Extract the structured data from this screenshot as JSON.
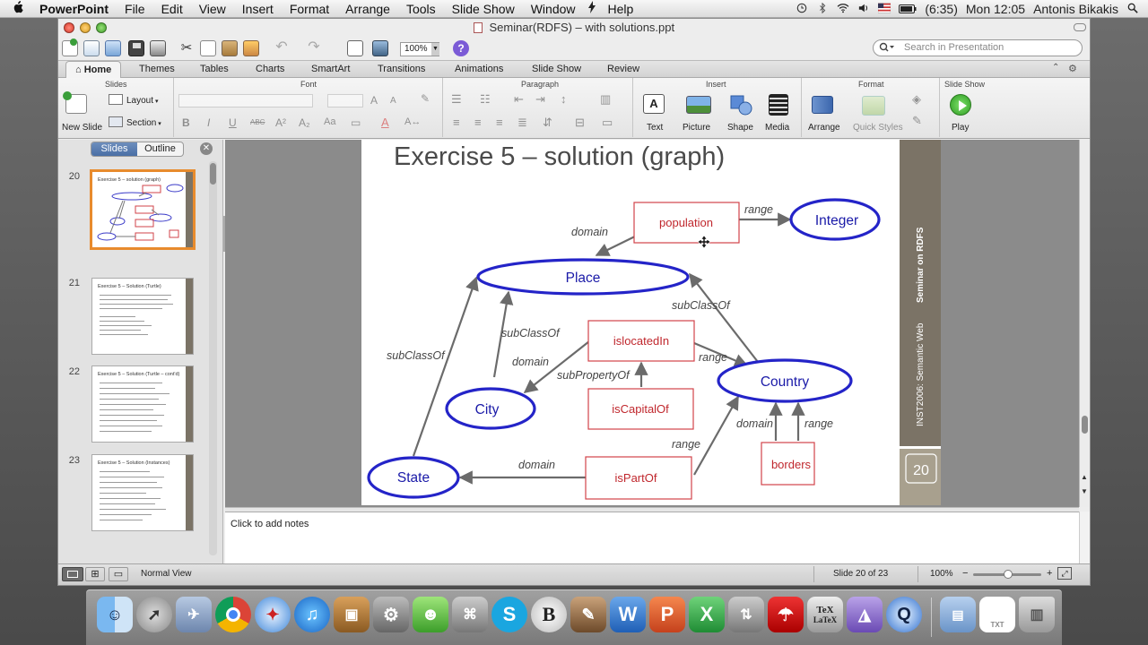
{
  "menubar": {
    "apple": "",
    "app_name": "PowerPoint",
    "menus": [
      "File",
      "Edit",
      "View",
      "Insert",
      "Format",
      "Arrange",
      "Tools",
      "Slide Show",
      "Window",
      "Help"
    ],
    "battery": "(6:35)",
    "clock": "Mon 12:05",
    "user": "Antonis Bikakis"
  },
  "window": {
    "title": "Seminar(RDFS) – with solutions.ppt",
    "zoom_field": "100%",
    "search_placeholder": "Search in Presentation"
  },
  "ribbon": {
    "tabs": [
      "Home",
      "Themes",
      "Tables",
      "Charts",
      "SmartArt",
      "Transitions",
      "Animations",
      "Slide Show",
      "Review"
    ],
    "groups": {
      "slides": "Slides",
      "font": "Font",
      "paragraph": "Paragraph",
      "insert": "Insert",
      "format": "Format",
      "slideshow": "Slide Show"
    },
    "buttons": {
      "new_slide": "New Slide",
      "layout": "Layout",
      "section": "Section",
      "text": "Text",
      "picture": "Picture",
      "shape": "Shape",
      "media": "Media",
      "arrange": "Arrange",
      "quick_styles": "Quick Styles",
      "play": "Play"
    }
  },
  "leftpane": {
    "tab_slides": "Slides",
    "tab_outline": "Outline",
    "thumbnails": [
      {
        "num": "20",
        "title": "Exercise 5 – solution (graph)"
      },
      {
        "num": "21",
        "title": "Exercise 5 – Solution (Turtle)"
      },
      {
        "num": "22",
        "title": "Exercise 5 – Solution (Turtle – cont'd)"
      },
      {
        "num": "23",
        "title": "Exercise 5 – Solution (Instances)"
      }
    ]
  },
  "slide": {
    "title": "Exercise 5 – solution (graph)",
    "side_text_course": "INST2006: Semantic Web",
    "side_text_seminar": "Seminar on RDFS",
    "page_number": "20",
    "nodes": {
      "population": "population",
      "integer": "Integer",
      "place": "Place",
      "islocatedin": "islocatedIn",
      "country": "Country",
      "city": "City",
      "iscapitalof": "isCapitalOf",
      "state": "State",
      "ispartof": "isPartOf",
      "borders": "borders"
    },
    "edges": {
      "range_1": "range",
      "domain_1": "domain",
      "subclassof_1": "subClassOf",
      "subclassof_2": "subClassOf",
      "subclassof_3": "subClassOf",
      "domain_2": "domain",
      "range_2": "range",
      "subpropertyof": "subPropertyOf",
      "range_3": "range",
      "domain_3": "domain",
      "domain_4": "domain",
      "range_4": "range"
    }
  },
  "notes": {
    "placeholder": "Click to add notes"
  },
  "statusbar": {
    "view": "Normal View",
    "slide_position": "Slide 20 of 23",
    "zoom": "100%"
  },
  "dock": {
    "skype": "S",
    "bbedit": "B",
    "word": "W",
    "powerpoint": "P",
    "excel": "X",
    "latex_top": "TeX",
    "latex_bottom": "LaTeX",
    "txt_file": "TXT"
  },
  "colors": {
    "ellipse_stroke": "#2424c8",
    "ellipse_text": "#1a1aa8",
    "rect_stroke": "#d2434a",
    "rect_text": "#c0272d",
    "edge": "#6b6b6b",
    "slide_sidebar": "#7b7366",
    "thumb_selected": "#e88b2d"
  }
}
